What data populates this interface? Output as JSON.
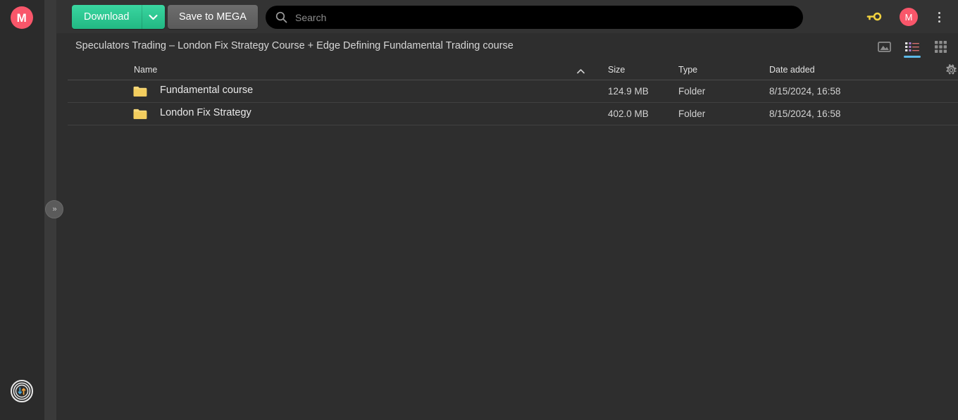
{
  "brand": {
    "logo_letter": "M",
    "logo_color": "#f9566a",
    "accent_green": "#2ec08c",
    "accent_blue": "#5cb9e8",
    "folder_color": "#f4d06a"
  },
  "toolbar": {
    "download_label": "Download",
    "download_caret_icon": "chevron-down-icon",
    "save_label": "Save to MEGA",
    "key_icon": "key-icon",
    "avatar_letter": "M",
    "menu_icon": "kebab-menu-icon"
  },
  "search": {
    "placeholder": "Search",
    "value": "",
    "icon": "search-icon"
  },
  "breadcrumb": {
    "path": "Speculators Trading – London Fix Strategy Course + Edge Defining Fundamental Trading course"
  },
  "views": {
    "gallery_icon": "image-view-icon",
    "list_icon": "list-view-icon",
    "grid_icon": "grid-view-icon",
    "active": "list"
  },
  "sidebar": {
    "expand_label": "»",
    "transfer_icon": "transfer-status-icon"
  },
  "table": {
    "settings_icon": "gear-icon",
    "sort_column": "Name",
    "sort_direction": "ascending",
    "columns": {
      "name": "Name",
      "size": "Size",
      "type": "Type",
      "date": "Date added"
    },
    "rows": [
      {
        "icon": "folder-icon",
        "name": "Fundamental course",
        "size": "124.9 MB",
        "type": "Folder",
        "date": "8/15/2024, 16:58"
      },
      {
        "icon": "folder-icon",
        "name": "London Fix Strategy",
        "size": "402.0 MB",
        "type": "Folder",
        "date": "8/15/2024, 16:58"
      }
    ]
  }
}
